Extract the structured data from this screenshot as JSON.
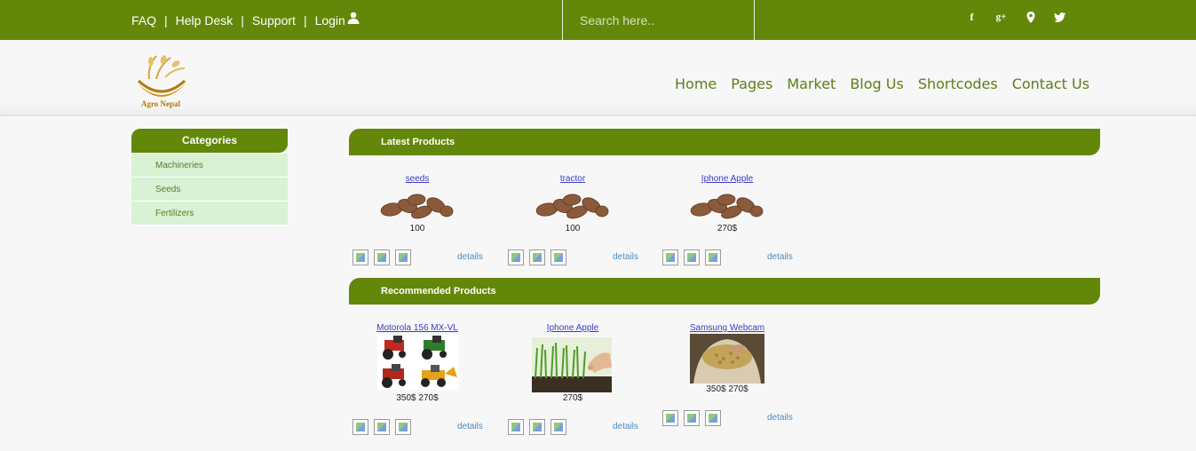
{
  "topbar": {
    "links": [
      "FAQ",
      "Help Desk",
      "Support",
      "Login"
    ],
    "separator": "|",
    "search_placeholder": "Search here..",
    "social": [
      "facebook-icon",
      "google-plus-icon",
      "location-icon",
      "twitter-icon"
    ],
    "social_glyphs": [
      "f",
      "g+",
      "",
      ""
    ]
  },
  "header": {
    "logo_text": "Agro Nepal",
    "nav": [
      "Home",
      "Pages",
      "Market",
      "Blog Us",
      "Shortcodes",
      "Contact Us"
    ]
  },
  "sidebar": {
    "title": "Categories",
    "items": [
      "Machineries",
      "Seeds",
      "Fertilizers"
    ]
  },
  "latest": {
    "title": "Latest Products",
    "products": [
      {
        "name": "seeds",
        "price": "100",
        "details": "details",
        "image": "seeds-image"
      },
      {
        "name": "tractor",
        "price": "100",
        "details": "details",
        "image": "seeds-image"
      },
      {
        "name": "Iphone Apple",
        "price": "270$",
        "details": "details",
        "image": "seeds-image"
      }
    ]
  },
  "recommended": {
    "title": "Recommended Products",
    "products": [
      {
        "name": "Motorola 156 MX-VL",
        "price": "350$ 270$",
        "details": "details",
        "image": "tractors-image"
      },
      {
        "name": "Iphone Apple",
        "price": "270$",
        "details": "details",
        "image": "seedlings-image"
      },
      {
        "name": "Samsung Webcam",
        "price": "350$ 270$",
        "details": "details",
        "image": "grain-sack-image"
      }
    ]
  },
  "colors": {
    "primary_green": "#638709",
    "category_bg": "#d9f2d5",
    "product_link": "#3b3bc4",
    "details_link": "#4a8bc2",
    "nav_text": "#5d7d16"
  }
}
